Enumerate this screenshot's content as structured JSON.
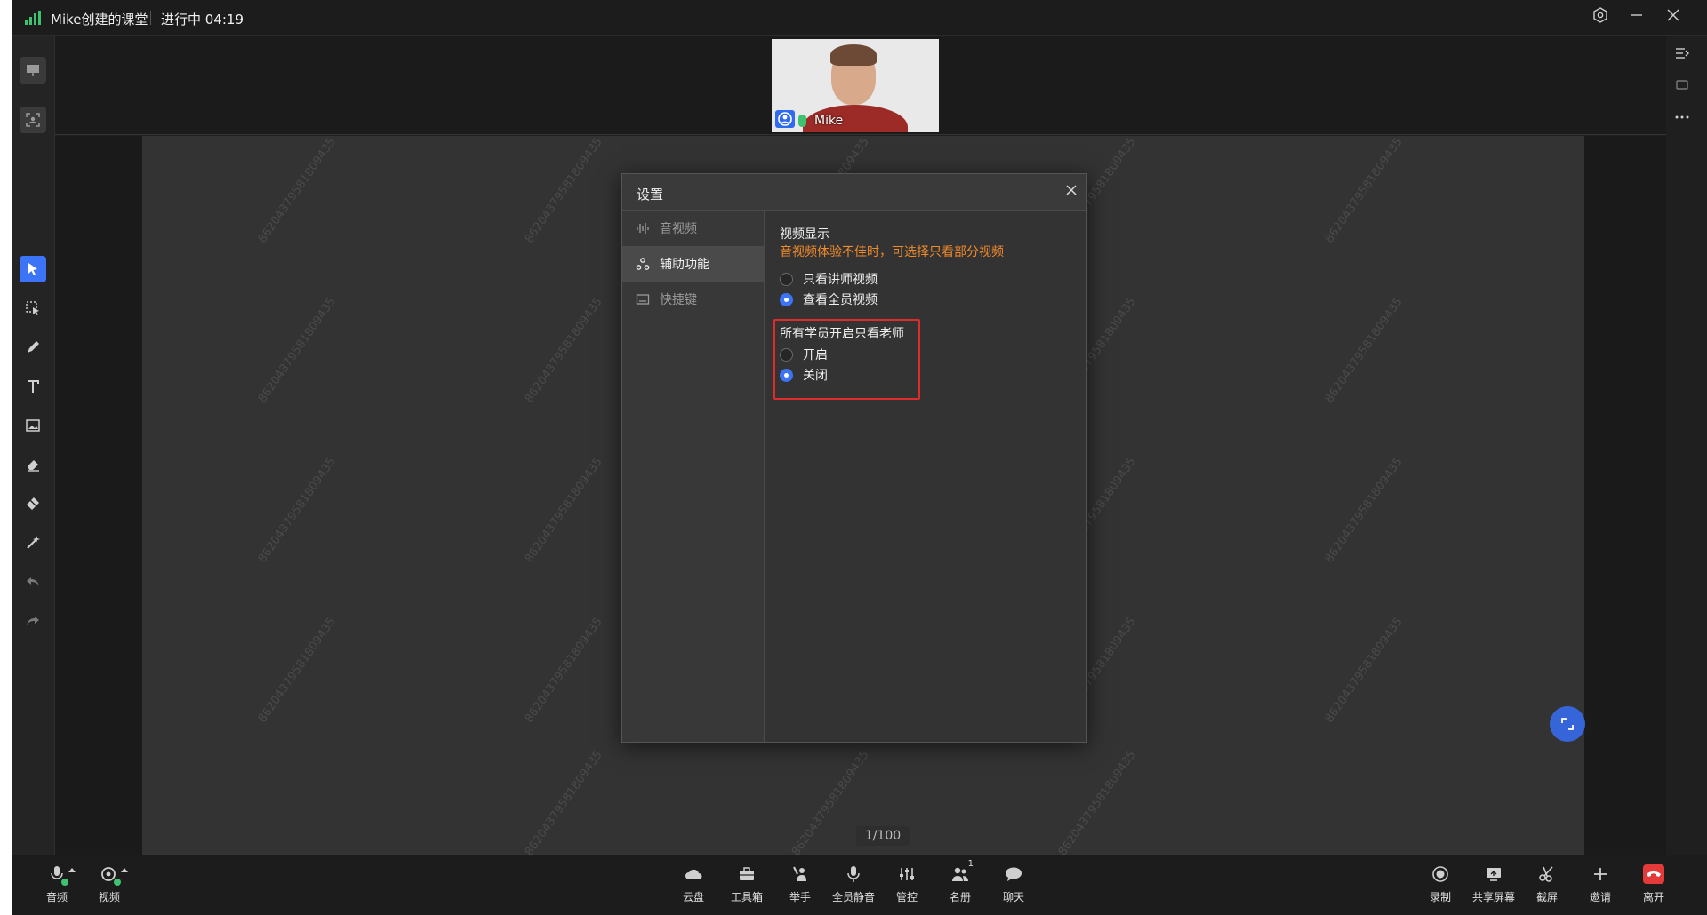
{
  "window": {
    "class_title": "Mike创建的课堂",
    "status": "进行中 04:19",
    "controls": [
      "settings-icon",
      "minimize-icon",
      "close-icon"
    ]
  },
  "video": {
    "participant_name": "Mike"
  },
  "whiteboard": {
    "watermark_text": "86204379581809435",
    "page_counter": "1/100"
  },
  "settings_dialog": {
    "title": "设置",
    "nav": [
      {
        "label": "音视频",
        "icon": "waveform-icon",
        "active": false
      },
      {
        "label": "辅助功能",
        "icon": "accessibility-icon",
        "active": true
      },
      {
        "label": "快捷键",
        "icon": "keyboard-icon",
        "active": false
      }
    ],
    "video_display": {
      "title": "视频显示",
      "hint": "音视频体验不佳时，可选择只看部分视频",
      "options": [
        {
          "label": "只看讲师视频",
          "selected": false
        },
        {
          "label": "查看全员视频",
          "selected": true
        }
      ]
    },
    "teacher_only": {
      "title": "所有学员开启只看老师",
      "options": [
        {
          "label": "开启",
          "selected": false
        },
        {
          "label": "关闭",
          "selected": true
        }
      ]
    }
  },
  "bottom_bar": {
    "left": [
      {
        "label": "音频",
        "icon": "microphone-icon"
      },
      {
        "label": "视频",
        "icon": "camera-icon"
      }
    ],
    "center": [
      {
        "label": "云盘",
        "icon": "cloud-icon"
      },
      {
        "label": "工具箱",
        "icon": "toolbox-icon"
      },
      {
        "label": "举手",
        "icon": "raise-hand-icon"
      },
      {
        "label": "全员静音",
        "icon": "mute-all-icon"
      },
      {
        "label": "管控",
        "icon": "sliders-icon"
      },
      {
        "label": "名册",
        "icon": "roster-icon",
        "badge": "1"
      },
      {
        "label": "聊天",
        "icon": "chat-icon"
      }
    ],
    "right": [
      {
        "label": "录制",
        "icon": "record-icon"
      },
      {
        "label": "共享屏幕",
        "icon": "share-screen-icon"
      },
      {
        "label": "截屏",
        "icon": "screenshot-icon"
      },
      {
        "label": "邀请",
        "icon": "invite-plus-icon"
      },
      {
        "label": "离开",
        "icon": "hang-up-icon"
      }
    ]
  },
  "colors": {
    "accent_blue": "#3b74f6",
    "warning_orange": "#f08a2b",
    "highlight_red": "#e02b2b",
    "leave_red": "#e53a3a",
    "signal_green": "#3ec26f"
  }
}
